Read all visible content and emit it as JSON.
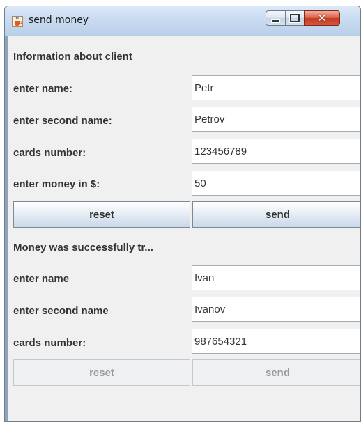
{
  "window": {
    "title": "send money",
    "icon": "java-cup-icon",
    "controls": {
      "minimize": "minimize-icon",
      "maximize": "maximize-icon",
      "close": "close-icon"
    }
  },
  "client_section": {
    "heading": "Information about client",
    "name_label": "enter name:",
    "name_value": "Petr",
    "second_name_label": "enter second name:",
    "second_name_value": "Petrov",
    "card_label": "cards number:",
    "card_value": "123456789",
    "money_label": "enter money in $:",
    "money_value": "50",
    "reset_label": "reset",
    "send_label": "send"
  },
  "recipient_section": {
    "status": "Money was successfully tr...",
    "name_label": "enter name",
    "name_value": "Ivan",
    "second_name_label": "enter second name",
    "second_name_value": "Ivanov",
    "card_label": "cards number:",
    "card_value": "987654321",
    "reset_label": "reset",
    "send_label": "send"
  },
  "colors": {
    "accent_close": "#c33a20",
    "label_text": "#333333",
    "disabled_text": "#9a9a9a"
  }
}
